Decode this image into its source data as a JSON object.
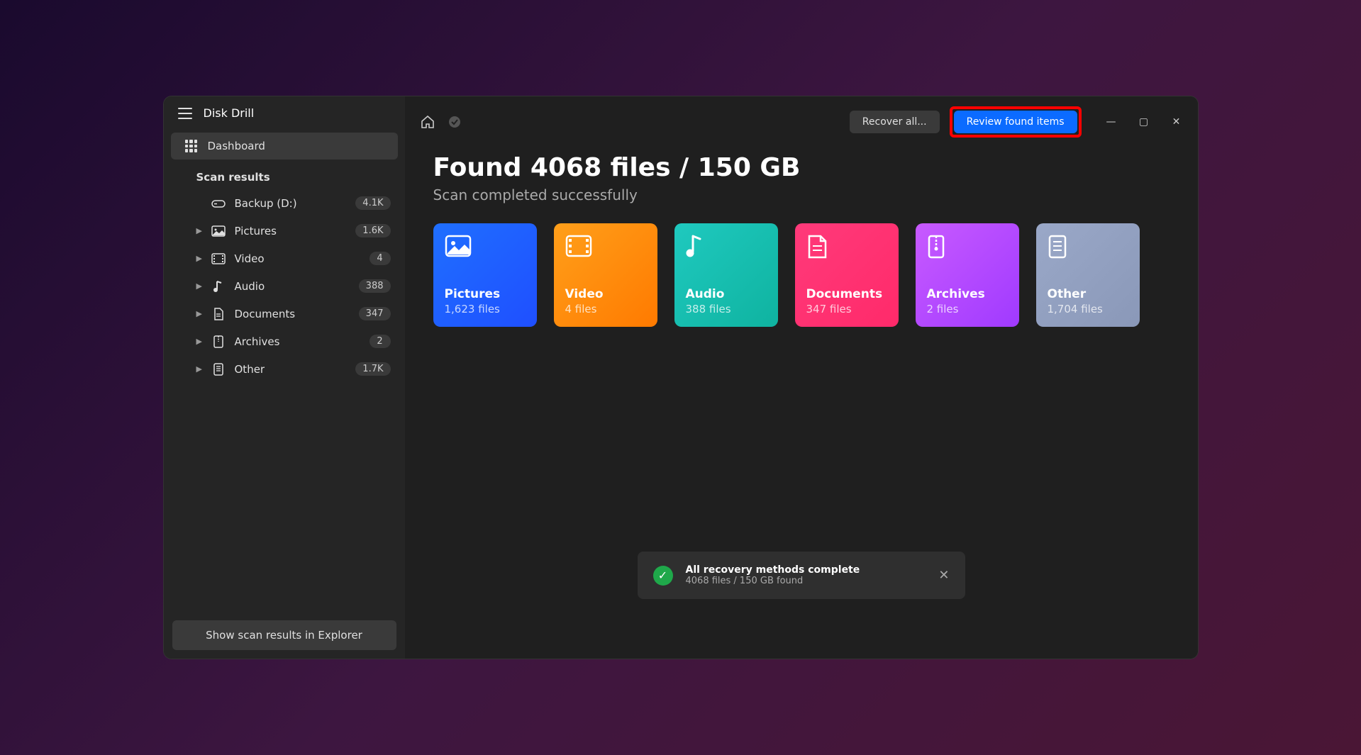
{
  "app": {
    "title": "Disk Drill"
  },
  "sidebar": {
    "dashboard": "Dashboard",
    "section": "Scan results",
    "root": {
      "label": "Backup (D:)",
      "count": "4.1K"
    },
    "items": [
      {
        "label": "Pictures",
        "count": "1.6K"
      },
      {
        "label": "Video",
        "count": "4"
      },
      {
        "label": "Audio",
        "count": "388"
      },
      {
        "label": "Documents",
        "count": "347"
      },
      {
        "label": "Archives",
        "count": "2"
      },
      {
        "label": "Other",
        "count": "1.7K"
      }
    ],
    "explorer_btn": "Show scan results in Explorer"
  },
  "toolbar": {
    "recover_all": "Recover all...",
    "review": "Review found items"
  },
  "main": {
    "heading": "Found 4068 files / 150 GB",
    "subheading": "Scan completed successfully",
    "cards": [
      {
        "title": "Pictures",
        "sub": "1,623 files"
      },
      {
        "title": "Video",
        "sub": "4 files"
      },
      {
        "title": "Audio",
        "sub": "388 files"
      },
      {
        "title": "Documents",
        "sub": "347 files"
      },
      {
        "title": "Archives",
        "sub": "2 files"
      },
      {
        "title": "Other",
        "sub": "1,704 files"
      }
    ]
  },
  "toast": {
    "title": "All recovery methods complete",
    "sub": "4068 files / 150 GB found"
  }
}
